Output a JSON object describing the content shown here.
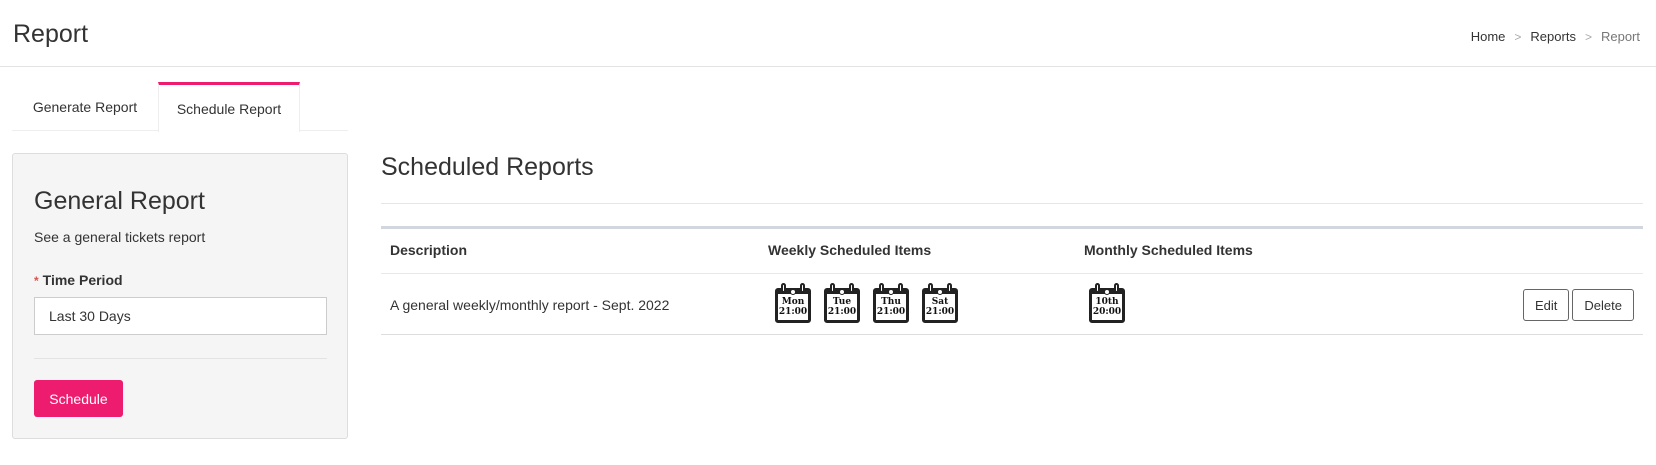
{
  "header": {
    "title": "Report",
    "breadcrumb": {
      "items": [
        "Home",
        "Reports",
        "Report"
      ],
      "separator": ">"
    }
  },
  "tabs": [
    {
      "label": "Generate Report",
      "active": false
    },
    {
      "label": "Schedule Report",
      "active": true
    }
  ],
  "form": {
    "title": "General Report",
    "description": "See a general tickets report",
    "required_mark": "*",
    "time_period_label": "Time Period",
    "time_period_value": "Last 30 Days",
    "schedule_label": "Schedule"
  },
  "scheduled": {
    "title": "Scheduled Reports",
    "columns": {
      "description": "Description",
      "weekly": "Weekly Scheduled Items",
      "monthly": "Monthly Scheduled Items"
    },
    "rows": [
      {
        "description": "A general weekly/monthly report - Sept. 2022",
        "weekly": [
          {
            "day": "Mon",
            "time": "21:00"
          },
          {
            "day": "Tue",
            "time": "21:00"
          },
          {
            "day": "Thu",
            "time": "21:00"
          },
          {
            "day": "Sat",
            "time": "21:00"
          }
        ],
        "monthly": [
          {
            "day": "10th",
            "time": "20:00"
          }
        ],
        "edit_label": "Edit",
        "delete_label": "Delete"
      }
    ]
  },
  "colors": {
    "accent": "#ee1c6e",
    "required": "#d9534f",
    "panel_bg": "#f5f5f5",
    "table_top_border": "#d2d6de"
  }
}
